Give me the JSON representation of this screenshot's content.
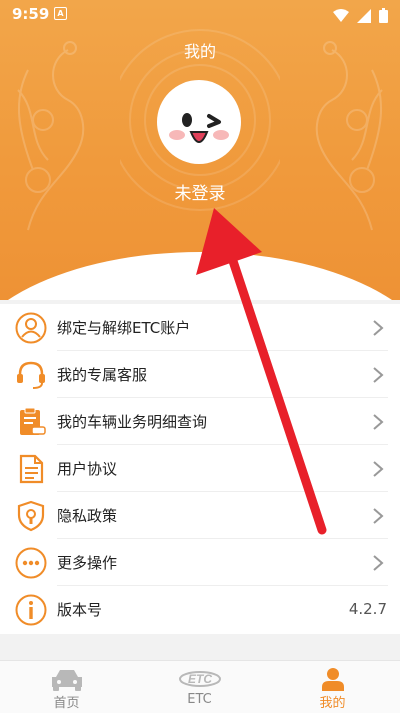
{
  "status_bar": {
    "time": "9:59",
    "notif_letter": "A"
  },
  "header": {
    "title": "我的",
    "login_text": "未登录"
  },
  "menu": {
    "items": [
      {
        "label": "绑定与解绑ETC账户",
        "icon": "user-outline-icon"
      },
      {
        "label": "我的专属客服",
        "icon": "headset-icon"
      },
      {
        "label": "我的车辆业务明细查询",
        "icon": "clipboard-car-icon"
      },
      {
        "label": "用户协议",
        "icon": "document-icon"
      },
      {
        "label": "隐私政策",
        "icon": "shield-lock-icon"
      },
      {
        "label": "更多操作",
        "icon": "more-dots-icon"
      },
      {
        "label": "版本号",
        "icon": "info-icon",
        "value": "4.2.7"
      }
    ]
  },
  "tabbar": {
    "tabs": [
      {
        "label": "首页",
        "icon": "car-icon"
      },
      {
        "label": "ETC",
        "icon": "etc-logo-icon"
      },
      {
        "label": "我的",
        "icon": "person-icon",
        "active": true
      }
    ]
  },
  "colors": {
    "accent": "#f08c28",
    "header": "#f09a3c",
    "arrow": "#e8202a"
  }
}
